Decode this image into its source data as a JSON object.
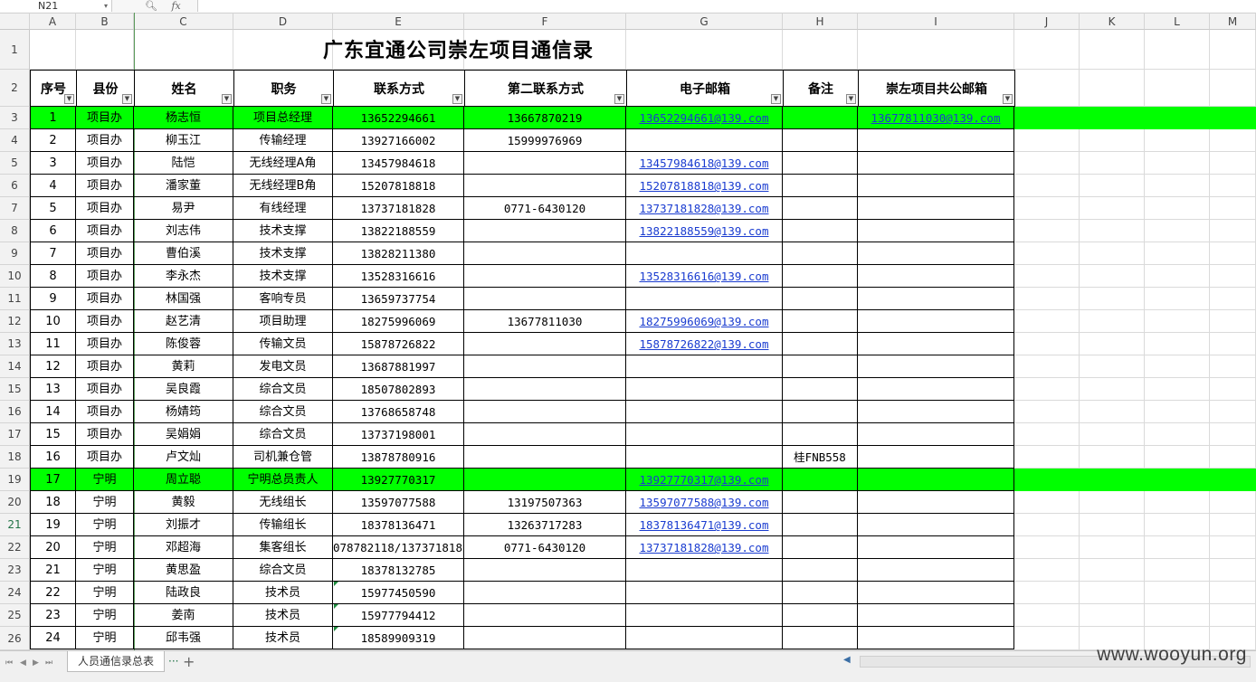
{
  "namebox": "N21",
  "formula_fx": "fx",
  "columns": [
    "A",
    "B",
    "C",
    "D",
    "E",
    "F",
    "G",
    "H",
    "I",
    "J",
    "K",
    "L",
    "M"
  ],
  "title": "广东宜通公司崇左项目通信录",
  "headers": [
    "序号",
    "县份",
    "姓名",
    "职务",
    "联系方式",
    "第二联系方式",
    "电子邮箱",
    "备注",
    "崇左项目共公邮箱"
  ],
  "rows": [
    [
      "1",
      "项目办",
      "杨志恒",
      "项目总经理",
      "13652294661",
      "13667870219",
      "13652294661@139.com",
      "",
      "13677811030@139.com"
    ],
    [
      "2",
      "项目办",
      "柳玉江",
      "传输经理",
      "13927166002",
      "15999976969",
      "",
      "",
      ""
    ],
    [
      "3",
      "项目办",
      "陆恺",
      "无线经理A角",
      "13457984618",
      "",
      "13457984618@139.com",
      "",
      ""
    ],
    [
      "4",
      "项目办",
      "潘家董",
      "无线经理B角",
      "15207818818",
      "",
      "15207818818@139.com",
      "",
      ""
    ],
    [
      "5",
      "项目办",
      "易尹",
      "有线经理",
      "13737181828",
      "0771-6430120",
      "13737181828@139.com",
      "",
      ""
    ],
    [
      "6",
      "项目办",
      "刘志伟",
      "技术支撑",
      "13822188559",
      "",
      "13822188559@139.com",
      "",
      ""
    ],
    [
      "7",
      "项目办",
      "曹伯溪",
      "技术支撑",
      "13828211380",
      "",
      "",
      "",
      ""
    ],
    [
      "8",
      "项目办",
      "李永杰",
      "技术支撑",
      "13528316616",
      "",
      "13528316616@139.com",
      "",
      ""
    ],
    [
      "9",
      "项目办",
      "林国强",
      "客响专员",
      "13659737754",
      "",
      "",
      "",
      ""
    ],
    [
      "10",
      "项目办",
      "赵艺清",
      "项目助理",
      "18275996069",
      "13677811030",
      "18275996069@139.com",
      "",
      ""
    ],
    [
      "11",
      "项目办",
      "陈俊蓉",
      "传输文员",
      "15878726822",
      "",
      "15878726822@139.com",
      "",
      ""
    ],
    [
      "12",
      "项目办",
      "黄莉",
      "发电文员",
      "13687881997",
      "",
      "",
      "",
      ""
    ],
    [
      "13",
      "项目办",
      "吴良霞",
      "综合文员",
      "18507802893",
      "",
      "",
      "",
      ""
    ],
    [
      "14",
      "项目办",
      "杨婧筠",
      "综合文员",
      "13768658748",
      "",
      "",
      "",
      ""
    ],
    [
      "15",
      "项目办",
      "吴娟娟",
      "综合文员",
      "13737198001",
      "",
      "",
      "",
      ""
    ],
    [
      "16",
      "项目办",
      "卢文灿",
      "司机兼仓管",
      "13878780916",
      "",
      "",
      "桂FNB558",
      ""
    ],
    [
      "17",
      "宁明",
      "周立聪",
      "宁明总员责人",
      "13927770317",
      "",
      "13927770317@139.com",
      "",
      ""
    ],
    [
      "18",
      "宁明",
      "黄毅",
      "无线组长",
      "13597077588",
      "13197507363",
      "13597077588@139.com",
      "",
      ""
    ],
    [
      "19",
      "宁明",
      "刘振才",
      "传输组长",
      "18378136471",
      "13263717283",
      "18378136471@139.com",
      "",
      ""
    ],
    [
      "20",
      "宁明",
      "邓超海",
      "集客组长",
      "078782118/13737181828",
      "0771-6430120",
      "13737181828@139.com",
      "",
      ""
    ],
    [
      "21",
      "宁明",
      "黄思盈",
      "综合文员",
      "18378132785",
      "",
      "",
      "",
      ""
    ],
    [
      "22",
      "宁明",
      "陆政良",
      "技术员",
      "15977450590",
      "",
      "",
      "",
      ""
    ],
    [
      "23",
      "宁明",
      "姜南",
      "技术员",
      "15977794412",
      "",
      "",
      "",
      ""
    ],
    [
      "24",
      "宁明",
      "邱韦强",
      "技术员",
      "18589909319",
      "",
      "",
      "",
      ""
    ]
  ],
  "row_numbers": [
    "1",
    "2",
    "3",
    "4",
    "5",
    "6",
    "7",
    "8",
    "9",
    "10",
    "11",
    "12",
    "13",
    "14",
    "15",
    "16",
    "17",
    "18",
    "19",
    "20",
    "21",
    "22",
    "23",
    "24",
    "25",
    "26"
  ],
  "highlight_color": "#00ff00",
  "link_color": "#1a3cd0",
  "sheet_tab": "人员通信录总表",
  "watermark": "www.wooyun.org"
}
